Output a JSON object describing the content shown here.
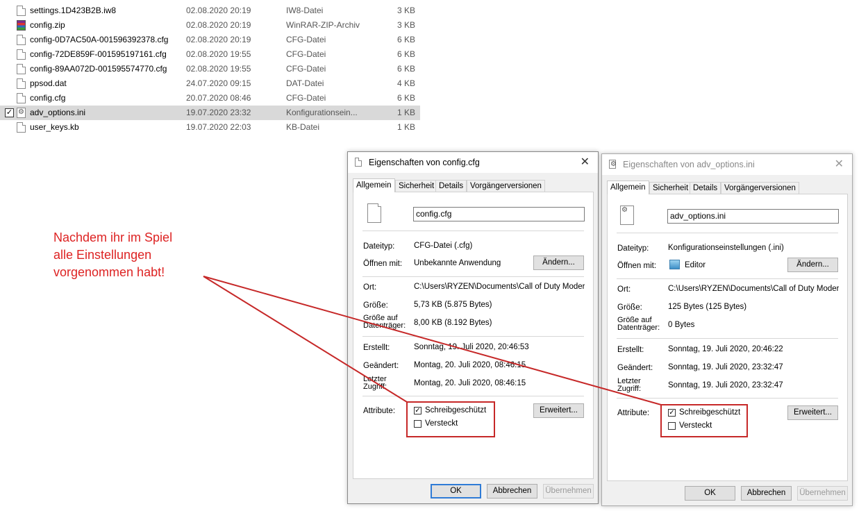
{
  "files": [
    {
      "name": "settings.1D423B2B.iw8",
      "date": "02.08.2020 20:19",
      "type": "IW8-Datei",
      "size": "3 KB",
      "icon": "document-icon",
      "selected": false
    },
    {
      "name": "config.zip",
      "date": "02.08.2020 20:19",
      "type": "WinRAR-ZIP-Archiv",
      "size": "3 KB",
      "icon": "winrar-archive-icon",
      "selected": false
    },
    {
      "name": "config-0D7AC50A-001596392378.cfg",
      "date": "02.08.2020 20:19",
      "type": "CFG-Datei",
      "size": "6 KB",
      "icon": "document-icon",
      "selected": false
    },
    {
      "name": "config-72DE859F-001595197161.cfg",
      "date": "02.08.2020 19:55",
      "type": "CFG-Datei",
      "size": "6 KB",
      "icon": "document-icon",
      "selected": false
    },
    {
      "name": "config-89AA072D-001595574770.cfg",
      "date": "02.08.2020 19:55",
      "type": "CFG-Datei",
      "size": "6 KB",
      "icon": "document-icon",
      "selected": false
    },
    {
      "name": "ppsod.dat",
      "date": "24.07.2020 09:15",
      "type": "DAT-Datei",
      "size": "4 KB",
      "icon": "document-icon",
      "selected": false
    },
    {
      "name": "config.cfg",
      "date": "20.07.2020 08:46",
      "type": "CFG-Datei",
      "size": "6 KB",
      "icon": "document-icon",
      "selected": false
    },
    {
      "name": "adv_options.ini",
      "date": "19.07.2020 23:32",
      "type": "Konfigurationsein...",
      "size": "1 KB",
      "icon": "ini-settings-icon",
      "selected": true
    },
    {
      "name": "user_keys.kb",
      "date": "19.07.2020 22:03",
      "type": "KB-Datei",
      "size": "1 KB",
      "icon": "document-icon",
      "selected": false
    }
  ],
  "annotation": {
    "text": "Nachdem ihr im Spiel\nalle Einstellungen\nvorgenommen habt!",
    "color": "#d22222"
  },
  "highlight_color": "#c62828",
  "tabs": [
    "Allgemein",
    "Sicherheit",
    "Details",
    "Vorgängerversionen"
  ],
  "labels": {
    "dateityp": "Dateityp:",
    "oeffnen_mit": "Öffnen mit:",
    "ort": "Ort:",
    "groesse": "Größe:",
    "groesse_datentraeger": "Größe auf\nDatenträger:",
    "erstellt": "Erstellt:",
    "geaendert": "Geändert:",
    "letzter_zugriff": "Letzter\nZugriff:",
    "attribute": "Attribute:",
    "schreibgeschuetzt": "Schreibgeschützt",
    "versteckt": "Versteckt"
  },
  "buttons": {
    "aendern": "Ändern...",
    "erweitert": "Erweitert...",
    "ok": "OK",
    "abbrechen": "Abbrechen",
    "uebernehmen": "Übernehmen"
  },
  "dialog1": {
    "title": "Eigenschaften von config.cfg",
    "filename": "config.cfg",
    "dateityp": "CFG-Datei (.cfg)",
    "oeffnen_mit": "Unbekannte Anwendung",
    "ort": "C:\\Users\\RYZEN\\Documents\\Call of Duty Modern W",
    "groesse": "5,73 KB (5.875 Bytes)",
    "groesse_datentraeger": "8,00 KB (8.192 Bytes)",
    "erstellt": "Sonntag, 19. Juli 2020, 20:46:53",
    "geaendert": "Montag, 20. Juli 2020, 08:46:15",
    "letzter_zugriff": "Montag, 20. Juli 2020, 08:46:15",
    "schreibgeschuetzt": true,
    "versteckt": false
  },
  "dialog2": {
    "title": "Eigenschaften von adv_options.ini",
    "filename": "adv_options.ini",
    "dateityp": "Konfigurationseinstellungen (.ini)",
    "oeffnen_mit": "Editor",
    "ort": "C:\\Users\\RYZEN\\Documents\\Call of Duty Modern W",
    "groesse": "125 Bytes (125 Bytes)",
    "groesse_datentraeger": "0 Bytes",
    "erstellt": "Sonntag, 19. Juli 2020, 20:46:22",
    "geaendert": "Sonntag, 19. Juli 2020, 23:32:47",
    "letzter_zugriff": "Sonntag, 19. Juli 2020, 23:32:47",
    "schreibgeschuetzt": true,
    "versteckt": false
  }
}
